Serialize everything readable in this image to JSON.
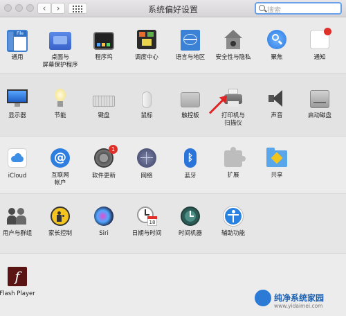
{
  "window": {
    "title": "系统偏好设置",
    "search_placeholder": "搜索"
  },
  "sections": [
    {
      "items": [
        {
          "label": "通用"
        },
        {
          "label": "桌面与\n屏幕保护程序"
        },
        {
          "label": "程序坞"
        },
        {
          "label": "调度中心"
        },
        {
          "label": "语言与地区"
        },
        {
          "label": "安全性与隐私"
        },
        {
          "label": "聚焦"
        },
        {
          "label": "通知"
        }
      ]
    },
    {
      "items": [
        {
          "label": "显示器"
        },
        {
          "label": "节能"
        },
        {
          "label": "键盘"
        },
        {
          "label": "鼠标"
        },
        {
          "label": "触控板"
        },
        {
          "label": "打印机与\n扫描仪"
        },
        {
          "label": "声音"
        },
        {
          "label": "启动磁盘"
        }
      ]
    },
    {
      "items": [
        {
          "label": "iCloud"
        },
        {
          "label": "互联网\n帐户"
        },
        {
          "label": "软件更新",
          "badge": "1"
        },
        {
          "label": "网络"
        },
        {
          "label": "蓝牙"
        },
        {
          "label": "扩展"
        },
        {
          "label": "共享"
        }
      ]
    },
    {
      "items": [
        {
          "label": "用户与群组"
        },
        {
          "label": "家长控制"
        },
        {
          "label": "Siri"
        },
        {
          "label": "日期与时间",
          "calendar_day": "18"
        },
        {
          "label": "时间机器"
        },
        {
          "label": "辅助功能"
        }
      ]
    },
    {
      "items": [
        {
          "label": "Flash Player"
        }
      ]
    }
  ],
  "icons": {
    "general": "File",
    "general_sub": "New\nOpe"
  },
  "watermark": {
    "name": "纯净系统家园",
    "url": "www.yidaimei.com"
  }
}
